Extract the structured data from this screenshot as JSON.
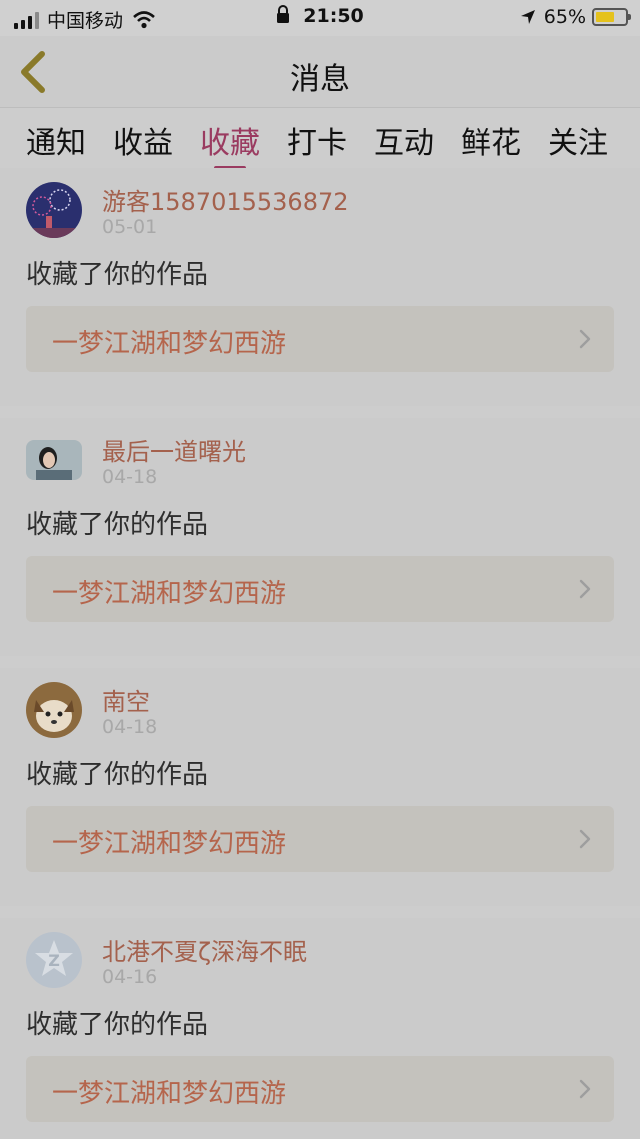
{
  "status_bar": {
    "carrier": "中国移动",
    "time": "21:50",
    "battery": "65%",
    "battery_level": 0.65
  },
  "header": {
    "title": "消息"
  },
  "tabs": [
    {
      "label": "通知"
    },
    {
      "label": "收益"
    },
    {
      "label": "收藏",
      "active": true
    },
    {
      "label": "打卡"
    },
    {
      "label": "互动"
    },
    {
      "label": "鲜花"
    },
    {
      "label": "关注"
    }
  ],
  "messages": [
    {
      "user": "游客1587015536872",
      "date": "05-01",
      "action": "收藏了你的作品",
      "work": "一梦江湖和梦幻西游",
      "avatar": "fireworks-avatar"
    },
    {
      "user": "最后一道曙光",
      "date": "04-18",
      "action": "收藏了你的作品",
      "work": "一梦江湖和梦幻西游",
      "avatar": "girl-photo-avatar"
    },
    {
      "user": "南空",
      "date": "04-18",
      "action": "收藏了你的作品",
      "work": "一梦江湖和梦幻西游",
      "avatar": "dog-photo-avatar"
    },
    {
      "user": "北港不夏ζ深海不眠",
      "date": "04-16",
      "action": "收藏了你的作品",
      "work": "一梦江湖和梦幻西游",
      "avatar": "qzone-default-avatar"
    }
  ],
  "colors": {
    "accent": "#9a3b60",
    "username": "#a4614d",
    "work_title": "#b5654c"
  }
}
